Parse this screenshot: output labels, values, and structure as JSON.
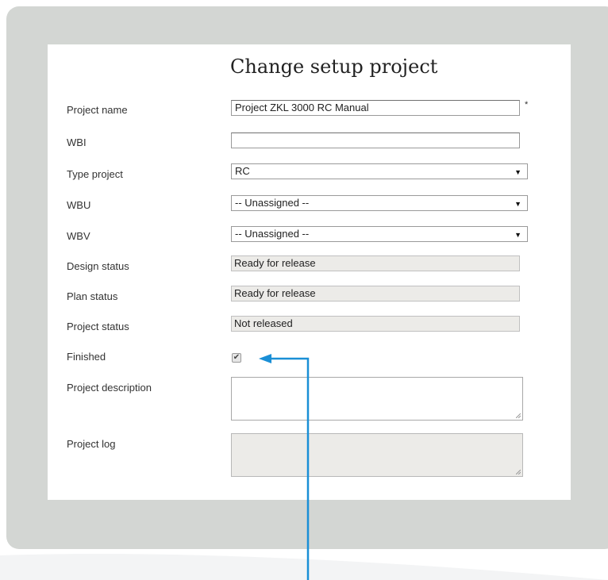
{
  "form": {
    "title": "Change setup project",
    "required_marker": "*",
    "fields": {
      "project_name": {
        "label": "Project name",
        "value": "Project ZKL 3000 RC Manual"
      },
      "wbi": {
        "label": "WBI",
        "value": ""
      },
      "type_project": {
        "label": "Type project",
        "value": "RC"
      },
      "wbu": {
        "label": "WBU",
        "value": "-- Unassigned --"
      },
      "wbv": {
        "label": "WBV",
        "value": "-- Unassigned --"
      },
      "design_status": {
        "label": "Design status",
        "value": "Ready for release"
      },
      "plan_status": {
        "label": "Plan status",
        "value": "Ready for release"
      },
      "project_status": {
        "label": "Project status",
        "value": "Not released"
      },
      "finished": {
        "label": "Finished",
        "checked": true,
        "check_glyph": "✔"
      },
      "project_description": {
        "label": "Project description",
        "value": ""
      },
      "project_log": {
        "label": "Project log",
        "value": ""
      }
    },
    "dropdown_arrow": "▼"
  },
  "colors": {
    "panel": "#d3d6d3",
    "callout": "#1a8fd6"
  }
}
